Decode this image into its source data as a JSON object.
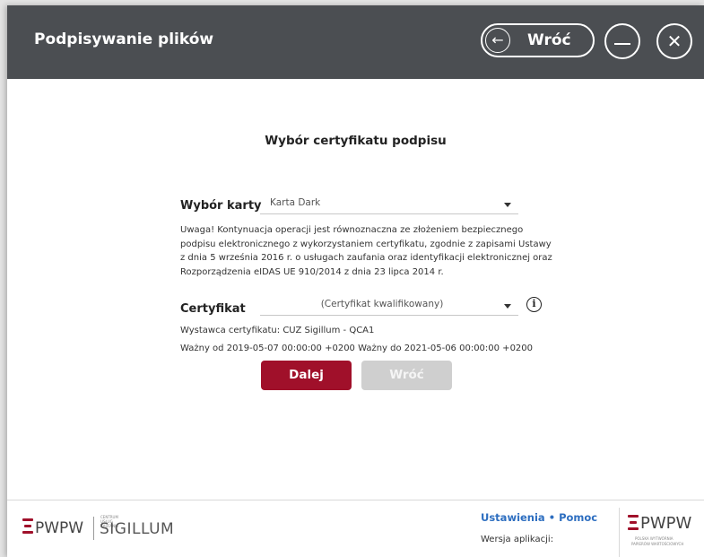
{
  "titlebar": {
    "title": "Podpisywanie plików",
    "back_label": "Wróć",
    "back_icon": "arrow-left-icon",
    "minimize_icon": "minimize-icon",
    "close_icon": "close-icon"
  },
  "main": {
    "section_title": "Wybór certyfikatu podpisu",
    "card_label": "Wybór karty",
    "card_value": "Karta Dark",
    "notice": "Uwaga! Kontynuacja operacji jest równoznaczna ze złożeniem bezpiecznego podpisu elektronicznego z wykorzystaniem certyfikatu, zgodnie z zapisami Ustawy z dnia 5 września 2016 r. o usługach zaufania oraz identyfikacji elektronicznej oraz Rozporządzenia eIDAS UE 910/2014 z dnia 23 lipca 2014 r.",
    "certificate_label": "Certyfikat",
    "certificate_value": "(Certyfikat kwalifikowany)",
    "issuer": "Wystawca certyfikatu: CUZ Sigillum - QCA1",
    "validity": "Ważny od 2019-05-07 00:00:00 +0200 Ważny do 2021-05-06 00:00:00 +0200",
    "next_button": "Dalej",
    "back_button": "Wróć"
  },
  "footer": {
    "logo_left_brand": "PWPW",
    "logo_left_small": "CENTRUM USŁUG ZAUFANIA",
    "logo_left_name": "SIGILLUM",
    "settings_link": "Ustawienia",
    "separator": "•",
    "help_link": "Pomoc",
    "version_label": "Wersja aplikacji:",
    "logo_right_brand": "PWPW",
    "logo_right_line1": "POLSKA WYTWÓRNIA",
    "logo_right_line2": "PAPIERÓW WARTOŚCIOWYCH"
  },
  "colors": {
    "titlebar": "#4b4e52",
    "primary": "#a0102a",
    "link": "#2d6ec0",
    "disabled": "#cfcfcf"
  }
}
